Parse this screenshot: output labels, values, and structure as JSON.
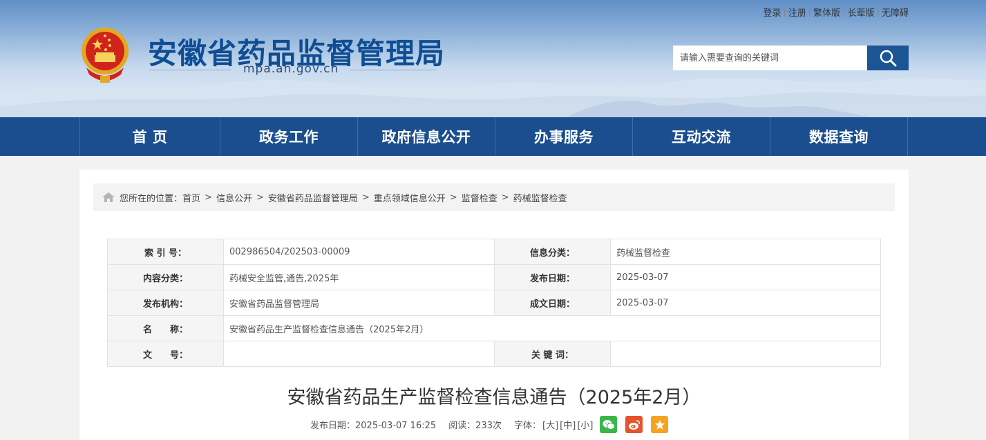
{
  "toplinks": {
    "login": "登录",
    "register": "注册",
    "traditional": "繁体版",
    "elderly": "长辈版",
    "accessible": "无障碍",
    "separator": "|"
  },
  "site": {
    "title": "安徽省药品监督管理局",
    "domain": "mpa.ah.gov.cn"
  },
  "search": {
    "placeholder": "请输入需要查询的关键词"
  },
  "nav": {
    "items": [
      {
        "label": "首 页"
      },
      {
        "label": "政务工作"
      },
      {
        "label": "政府信息公开"
      },
      {
        "label": "办事服务"
      },
      {
        "label": "互动交流"
      },
      {
        "label": "数据查询"
      }
    ]
  },
  "breadcrumb": {
    "prefix": "您所在的位置：",
    "separator": ">",
    "items": [
      "首页",
      "信息公开",
      "安徽省药品监督管理局",
      "重点领域信息公开",
      "监督检查",
      "药械监督检查"
    ]
  },
  "meta": {
    "index_label": "索 引 号：",
    "index_value": "002986504/202503-00009",
    "category_label": "信息分类：",
    "category_value": "药械监督检查",
    "content_label": "内容分类：",
    "content_value": "药械安全监管,通告,2025年",
    "pubdate_label": "发布日期：",
    "pubdate_value": "2025-03-07",
    "org_label": "发布机构：",
    "org_value": "安徽省药品监督管理局",
    "doc_date_label": "成文日期：",
    "doc_date_value": "2025-03-07",
    "name_label": "名　　称：",
    "name_value": "安徽省药品生产监督检查信息通告（2025年2月）",
    "docno_label": "文　　号：",
    "docno_value": "",
    "keywords_label": "关 键 词：",
    "keywords_value": ""
  },
  "article": {
    "title": "安徽省药品生产监督检查信息通告（2025年2月）",
    "pubdate": "发布日期：2025-03-07 16:25",
    "reads": "阅读：233次",
    "font_label": "字体：",
    "font_large": "[大]",
    "font_medium": "[中]",
    "font_small": "[小]"
  },
  "colors": {
    "brand_blue": "#1b4e8e",
    "title_blue": "#0f4d93",
    "wechat": "#3bb54a",
    "weibo": "#e5542c",
    "favorite": "#f5a321"
  },
  "icons": [
    "national-emblem-icon",
    "search-icon",
    "home-icon",
    "wechat-icon",
    "weibo-icon",
    "favorite-icon"
  ]
}
